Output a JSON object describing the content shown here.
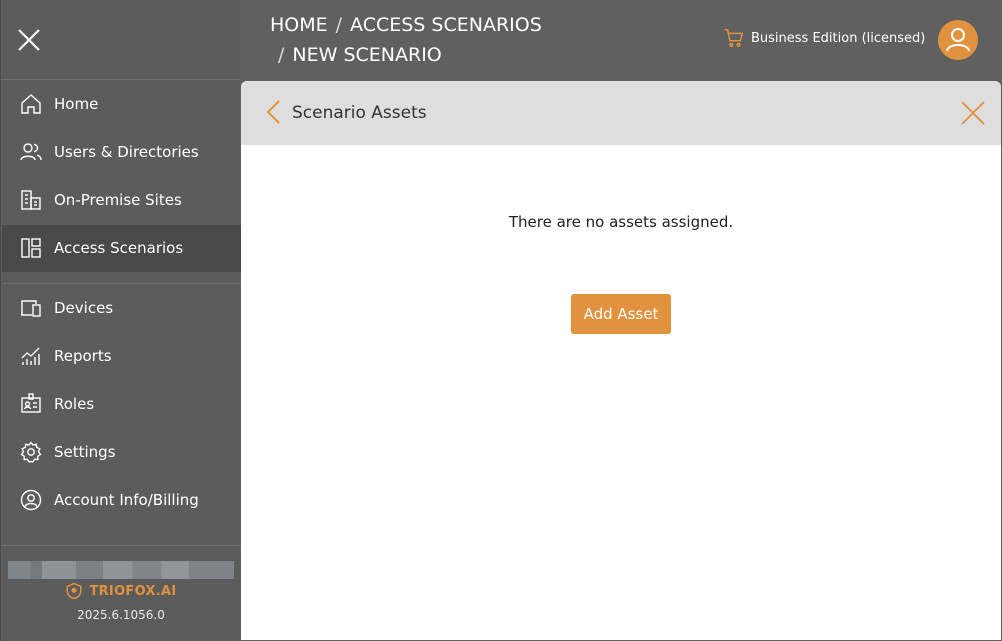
{
  "sidebar": {
    "items": [
      {
        "label": "Home",
        "icon": "home-icon"
      },
      {
        "label": "Users & Directories",
        "icon": "users-icon"
      },
      {
        "label": "On-Premise Sites",
        "icon": "buildings-icon"
      },
      {
        "label": "Access Scenarios",
        "icon": "layout-icon",
        "active": true
      },
      {
        "label": "Devices",
        "icon": "devices-icon"
      },
      {
        "label": "Reports",
        "icon": "chart-icon"
      },
      {
        "label": "Roles",
        "icon": "id-card-icon"
      },
      {
        "label": "Settings",
        "icon": "gear-icon"
      },
      {
        "label": "Account Info/Billing",
        "icon": "user-circle-icon"
      }
    ],
    "brand": "TRIOFOX.AI",
    "version": "2025.6.1056.0"
  },
  "header": {
    "breadcrumb": [
      "HOME",
      "ACCESS SCENARIOS",
      "NEW SCENARIO"
    ],
    "separator": "/",
    "edition": "Business Edition (licensed)"
  },
  "panel": {
    "title": "Scenario Assets",
    "empty_message": "There are no assets assigned.",
    "add_button": "Add Asset"
  },
  "colors": {
    "accent": "#e0923f",
    "sidebar_bg": "#5c5c5c",
    "active_bg": "#4a4a4a",
    "panel_head_bg": "#dedede"
  }
}
